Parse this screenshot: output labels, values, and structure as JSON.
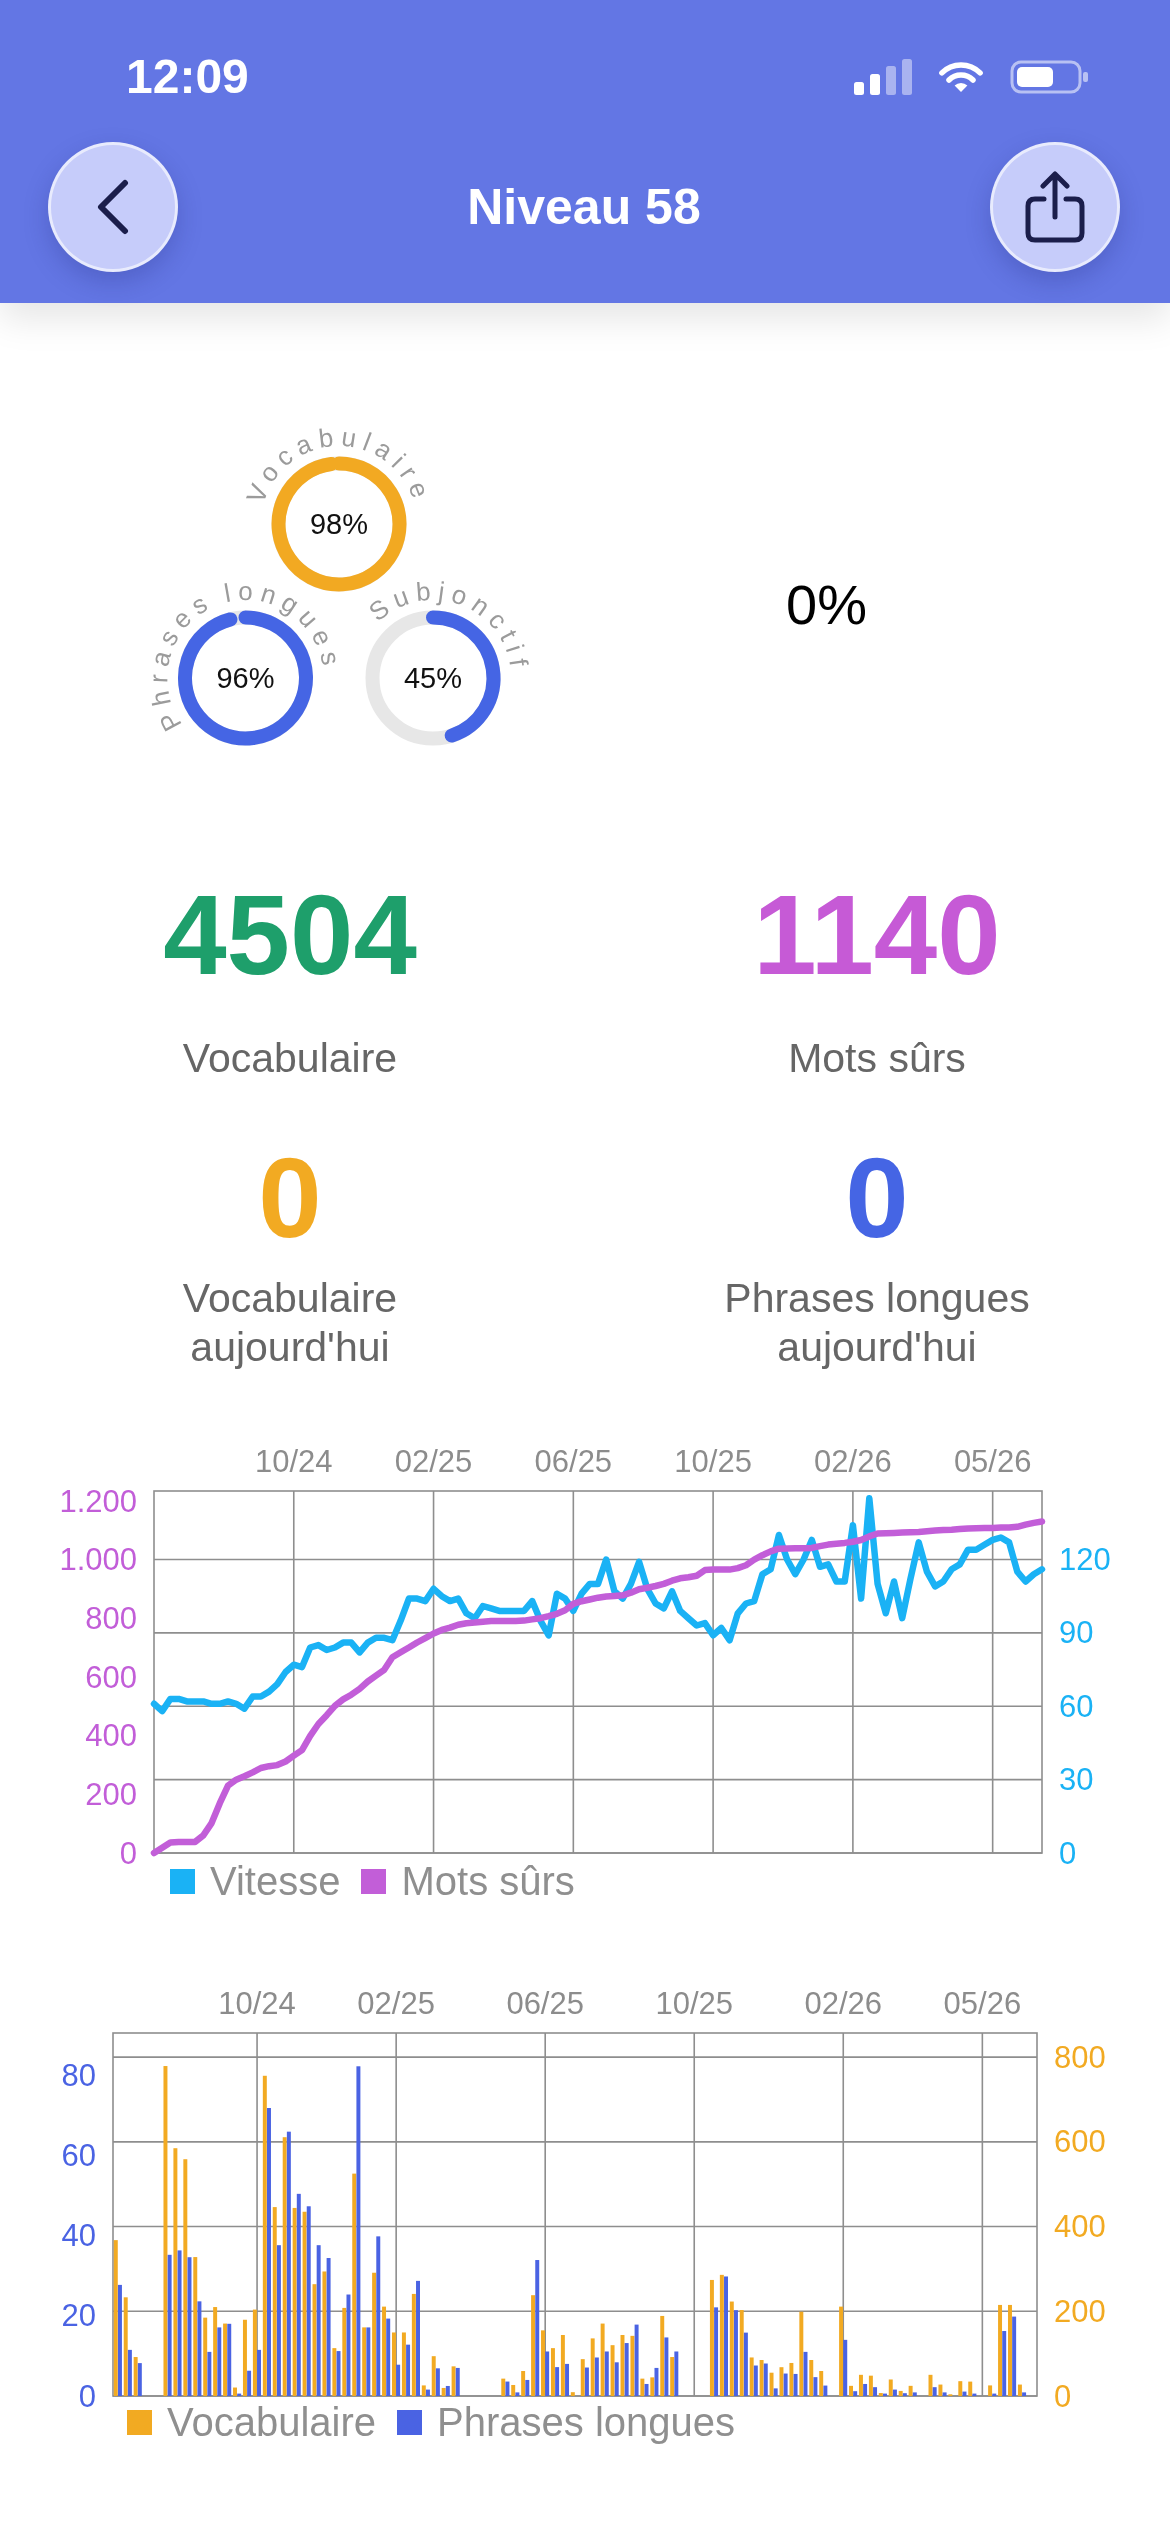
{
  "status_bar": {
    "time": "12:09"
  },
  "header": {
    "title": "Niveau 58"
  },
  "rings": [
    {
      "label_words": [
        "Vocabulaire"
      ],
      "value": "98%",
      "level": 0.98,
      "color": "#F2A922"
    },
    {
      "label_words": [
        "Phrases",
        "longues"
      ],
      "value": "96%",
      "level": 0.96,
      "color": "#4565E4"
    },
    {
      "label_words": [
        "Subjonctif"
      ],
      "value": "45%",
      "level": 0.45,
      "color": "#4565E4"
    }
  ],
  "side_value": "0%",
  "stats": [
    {
      "value": "4504",
      "label": "Vocabulaire",
      "color": "#1E9F6B"
    },
    {
      "value": "1140",
      "label": "Mots sûrs",
      "color": "#C65AD6"
    },
    {
      "value": "0",
      "label": "Vocabulaire aujourd'hui",
      "color": "#F2AA22"
    },
    {
      "value": "0",
      "label": "Phrases longues aujourd'hui",
      "color": "#4565E4"
    }
  ],
  "line_chart": {
    "chart_data": {
      "type": "line",
      "grid": true,
      "categories": [
        null,
        null,
        null,
        null,
        null,
        null,
        null,
        null,
        null,
        null,
        null,
        null,
        null,
        null,
        null,
        null,
        null,
        "10/24",
        null,
        null,
        null,
        null,
        null,
        null,
        null,
        null,
        null,
        null,
        null,
        null,
        null,
        null,
        null,
        null,
        "02/25",
        null,
        null,
        null,
        null,
        null,
        null,
        null,
        null,
        null,
        null,
        null,
        null,
        null,
        null,
        null,
        null,
        "06/25",
        null,
        null,
        null,
        null,
        null,
        null,
        null,
        null,
        null,
        null,
        null,
        null,
        null,
        null,
        null,
        null,
        "10/25",
        null,
        null,
        null,
        null,
        null,
        null,
        null,
        null,
        null,
        null,
        null,
        null,
        null,
        null,
        null,
        null,
        "02/26",
        null,
        null,
        null,
        null,
        null,
        null,
        null,
        null,
        null,
        null,
        null,
        null,
        null,
        null,
        null,
        null,
        "05/26",
        null,
        null,
        null,
        null,
        null,
        null
      ],
      "ylim": [
        0,
        1235
      ],
      "yticks": [
        0,
        200,
        400,
        600,
        800,
        {
          "value": 1000,
          "label": "1.000"
        },
        {
          "value": 1200,
          "label": "1.200"
        }
      ],
      "y2lim": [
        0,
        148
      ],
      "y2ticks": [
        0,
        30,
        60,
        90,
        120
      ],
      "series": [
        {
          "name": "Vitesse",
          "color": "#1AB2F5",
          "axis": "y2",
          "values": [
            61,
            58,
            63,
            63,
            62,
            62,
            62,
            61,
            61,
            62,
            61,
            59,
            64,
            64,
            66,
            69,
            74,
            77,
            76,
            84,
            85,
            83,
            84,
            86,
            86,
            82,
            86,
            88,
            88,
            87,
            95,
            104,
            104,
            103,
            108,
            105,
            103,
            104,
            98,
            96,
            101,
            100,
            99,
            99,
            99,
            99,
            103,
            95,
            89,
            106,
            104,
            99,
            106,
            110,
            110,
            120,
            107,
            104,
            110,
            119,
            108,
            102,
            100,
            107,
            99,
            96,
            93,
            94,
            89,
            92,
            87,
            98,
            102,
            103,
            114,
            116,
            130,
            120,
            114,
            120,
            128,
            117,
            118,
            111,
            111,
            134,
            104,
            145,
            110,
            98,
            111,
            96,
            112,
            127,
            115,
            109,
            111,
            116,
            118,
            124,
            124,
            126,
            128,
            129,
            127,
            115,
            111,
            114,
            116
          ]
        },
        {
          "name": "Mots sûrs",
          "color": "#C25ED8",
          "values": [
            0,
            18,
            36,
            38,
            38,
            38,
            60,
            102,
            170,
            230,
            250,
            262,
            275,
            290,
            296,
            300,
            312,
            332,
            351,
            400,
            440,
            470,
            502,
            524,
            540,
            560,
            585,
            605,
            625,
            668,
            685,
            701,
            718,
            733,
            749,
            761,
            769,
            779,
            784,
            786,
            789,
            791,
            792,
            792,
            792,
            793,
            797,
            801,
            808,
            816,
            828,
            850,
            859,
            865,
            871,
            875,
            877,
            879,
            888,
            900,
            905,
            911,
            918,
            929,
            937,
            941,
            946,
            965,
            967,
            967,
            967,
            972,
            982,
            1001,
            1016,
            1029,
            1038,
            1039,
            1040,
            1040,
            1041,
            1047,
            1052,
            1055,
            1058,
            1062,
            1068,
            1080,
            1090,
            1091,
            1092,
            1093,
            1094,
            1095,
            1098,
            1100,
            1102,
            1103,
            1105,
            1107,
            1108,
            1109,
            1109,
            1110,
            1110,
            1113,
            1120,
            1126,
            1131
          ]
        }
      ]
    }
  },
  "bar_chart": {
    "chart_data": {
      "type": "bar",
      "grid": true,
      "categories": [
        null,
        null,
        null,
        null,
        null,
        null,
        null,
        null,
        null,
        null,
        null,
        null,
        null,
        null,
        "10/24",
        null,
        null,
        null,
        null,
        null,
        null,
        null,
        null,
        null,
        null,
        null,
        null,
        null,
        "02/25",
        null,
        null,
        null,
        null,
        null,
        null,
        null,
        null,
        null,
        null,
        null,
        null,
        null,
        null,
        "06/25",
        null,
        null,
        null,
        null,
        null,
        null,
        null,
        null,
        null,
        null,
        null,
        null,
        null,
        null,
        "10/25",
        null,
        null,
        null,
        null,
        null,
        null,
        null,
        null,
        null,
        null,
        null,
        null,
        null,
        null,
        "02/26",
        null,
        null,
        null,
        null,
        null,
        null,
        null,
        null,
        null,
        null,
        null,
        null,
        null,
        "05/26",
        null,
        null,
        null,
        null,
        null
      ],
      "ylim": [
        0,
        90.5
      ],
      "yticks": [
        0,
        20,
        40,
        60,
        80
      ],
      "y2lim": [
        0,
        857
      ],
      "y2ticks": [
        0,
        200,
        400,
        600,
        800
      ],
      "series": [
        {
          "name": "Vocabulaire",
          "color": "#F2AA22",
          "axis": "y2",
          "values": [
            368,
            233,
            92,
            null,
            null,
            779,
            585,
            559,
            328,
            185,
            210,
            171,
            20,
            180,
            204,
            756,
            446,
            611,
            444,
            435,
            264,
            294,
            113,
            208,
            525,
            162,
            291,
            211,
            150,
            150,
            241,
            25,
            94,
            19,
            70,
            null,
            null,
            null,
            null,
            41,
            26,
            59,
            238,
            155,
            113,
            144,
            9,
            87,
            136,
            171,
            120,
            144,
            142,
            41,
            44,
            189,
            92,
            null,
            null,
            null,
            274,
            286,
            223,
            203,
            91,
            85,
            55,
            68,
            78,
            199,
            85,
            59,
            null,
            211,
            24,
            50,
            48,
            7,
            39,
            12,
            24,
            null,
            50,
            27,
            4,
            35,
            34,
            null,
            25,
            215,
            215,
            27,
            null
          ]
        },
        {
          "name": "Phrases longues",
          "color": "#4A63E3",
          "values": [
            27.7,
            11.5,
            8.2,
            null,
            null,
            35.2,
            36.3,
            34.6,
            23.6,
            11,
            17.1,
            18,
            0.6,
            6.3,
            11.5,
            71.8,
            37.6,
            65.9,
            50.4,
            47.3,
            37.6,
            34.4,
            11.2,
            25.3,
            82.2,
            17.1,
            39.8,
            19.3,
            7.8,
            12.8,
            28.7,
            1.6,
            6.9,
            2.5,
            7,
            null,
            null,
            null,
            null,
            3.6,
            0.9,
            4,
            33.9,
            11.1,
            7.2,
            8,
            null,
            7.1,
            9.6,
            11.1,
            8.4,
            13.2,
            17.8,
            3,
            7,
            14.6,
            11.1,
            null,
            null,
            null,
            22.1,
            29.8,
            21.4,
            15.8,
            7.6,
            8.1,
            1.9,
            5.6,
            5.5,
            11,
            4.7,
            2.6,
            null,
            14,
            1.2,
            3,
            2.2,
            0.6,
            1.6,
            0.7,
            0.9,
            null,
            2.2,
            0.9,
            null,
            1.1,
            0.6,
            null,
            0.6,
            16.2,
            19.8,
            0.9,
            null
          ]
        }
      ]
    }
  }
}
